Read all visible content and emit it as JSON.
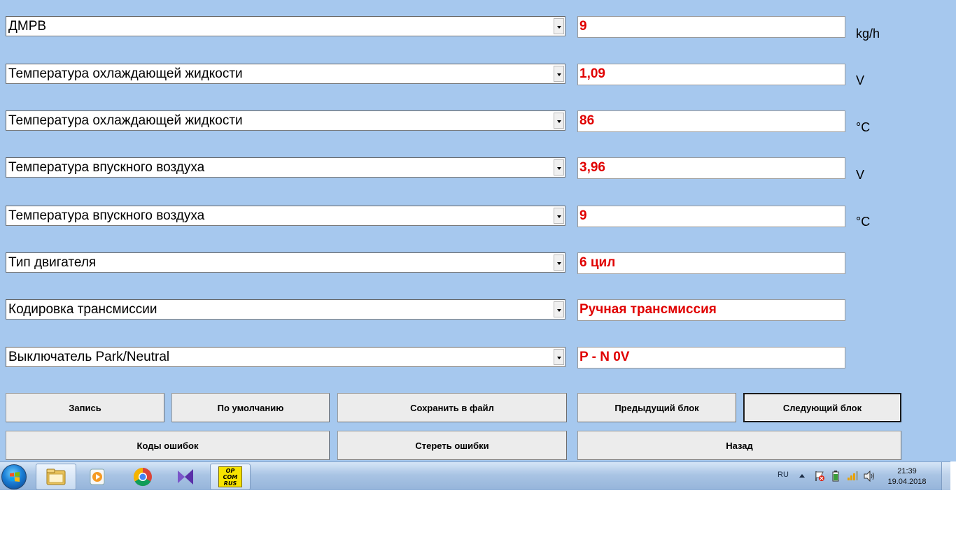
{
  "params": [
    {
      "label": "ДМРВ",
      "value": "9",
      "unit": "kg/h"
    },
    {
      "label": "Температура охлаждающей жидкости",
      "value": "1,09",
      "unit": "V"
    },
    {
      "label": "Температура охлаждающей жидкости",
      "value": "86",
      "unit": "°C"
    },
    {
      "label": "Температура впускного воздуха",
      "value": "3,96",
      "unit": "V"
    },
    {
      "label": "Температура впускного воздуха",
      "value": "9",
      "unit": "°C"
    },
    {
      "label": "Тип двигателя",
      "value": "6 цил",
      "unit": ""
    },
    {
      "label": "Кодировка трансмиссии",
      "value": "Ручная трансмиссия",
      "unit": ""
    },
    {
      "label": "Выключатель Park/Neutral",
      "value": "P - N  0V",
      "unit": ""
    }
  ],
  "buttons": {
    "record": "Запись",
    "default": "По умолчанию",
    "save_file": "Сохранить в файл",
    "prev_block": "Предыдущий блок",
    "next_block": "Следующий блок",
    "error_codes": "Коды ошибок",
    "clear_errors": "Стереть ошибки",
    "back": "Назад"
  },
  "taskbar": {
    "apps": [
      "file-explorer-icon",
      "media-player-icon",
      "chrome-icon",
      "visual-studio-icon",
      "opcom-icon"
    ],
    "opcom_label": [
      "OP",
      "COM",
      "RUS"
    ],
    "language": "RU",
    "time": "21:39",
    "date": "19.04.2018"
  },
  "colors": {
    "background": "#a6c8ee",
    "value_text": "#e00000"
  }
}
